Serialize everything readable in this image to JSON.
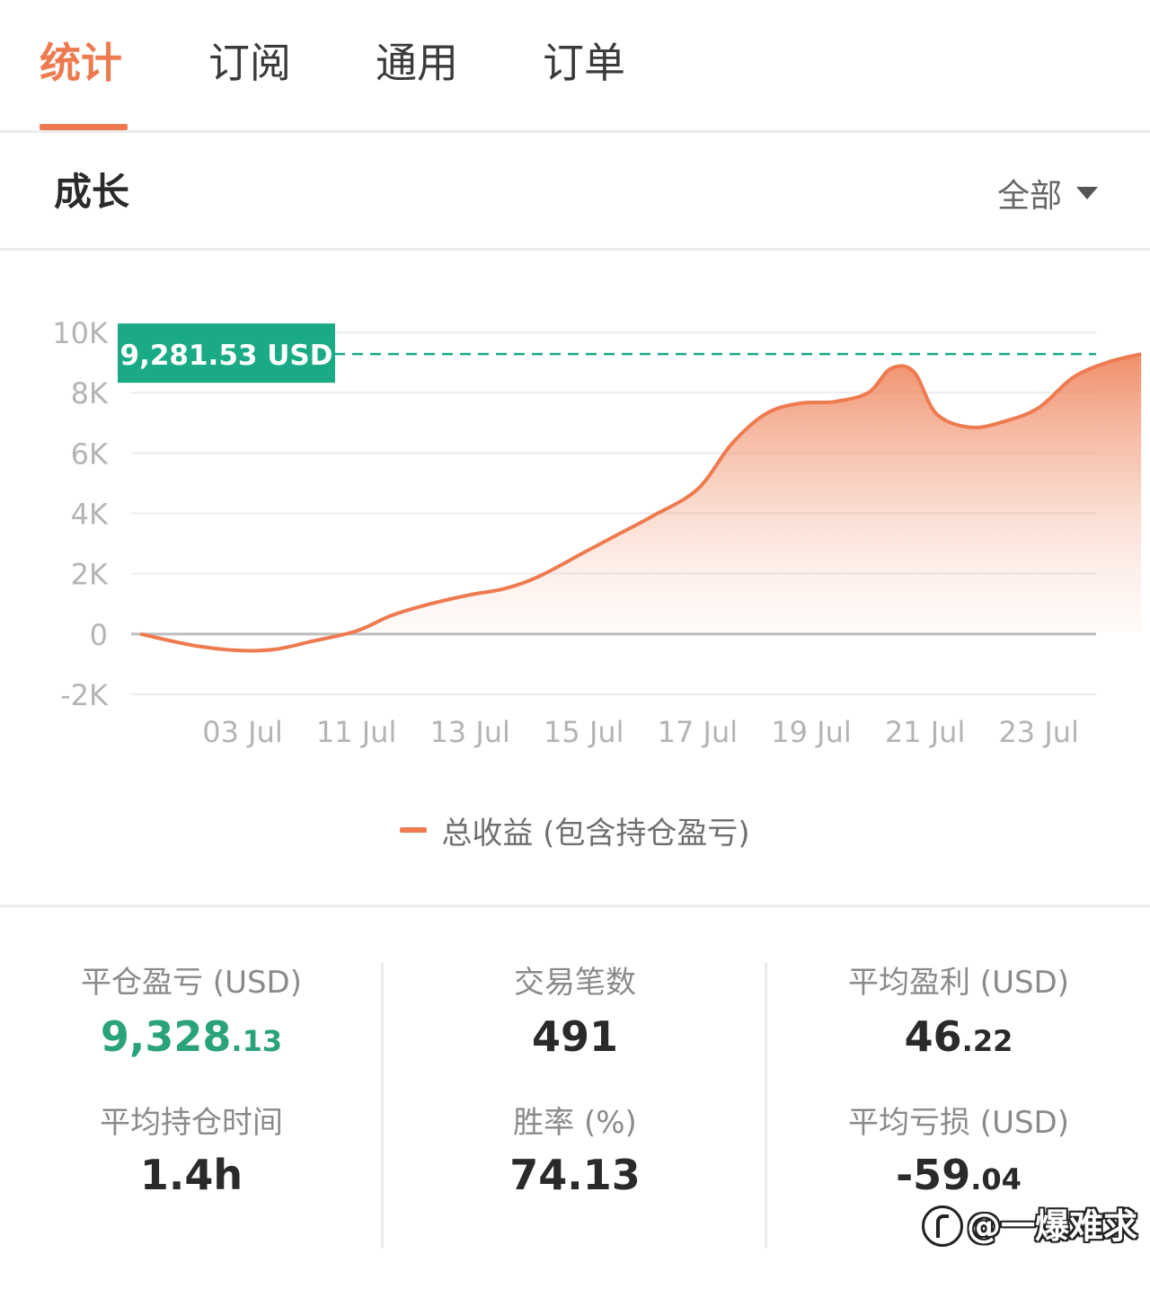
{
  "tabs": [
    {
      "label": "统计",
      "active": true
    },
    {
      "label": "订阅",
      "active": false
    },
    {
      "label": "通用",
      "active": false
    },
    {
      "label": "订单",
      "active": false
    }
  ],
  "section": {
    "title": "成长",
    "range_label": "全部"
  },
  "colors": {
    "accent": "#ee7a4f",
    "positive": "#2aa27c",
    "tooltip_bg": "#1aaa85"
  },
  "chart_data": {
    "type": "area",
    "x_ticks": [
      "03 Jul",
      "11 Jul",
      "13 Jul",
      "15 Jul",
      "17 Jul",
      "19 Jul",
      "21 Jul",
      "23 Jul"
    ],
    "y_ticks": [
      "10K",
      "8K",
      "6K",
      "4K",
      "2K",
      "0",
      "-2K"
    ],
    "ylim": [
      -2000,
      10000
    ],
    "grid": true,
    "legend_position": "bottom",
    "series": [
      {
        "name": "总收益 (包含持仓盈亏)",
        "points": [
          [
            -0.9,
            0
          ],
          [
            -0.4,
            -400
          ],
          [
            0,
            -550
          ],
          [
            0.3,
            -500
          ],
          [
            0.6,
            -250
          ],
          [
            1.0,
            100
          ],
          [
            1.3,
            600
          ],
          [
            1.6,
            950
          ],
          [
            2.0,
            1300
          ],
          [
            2.3,
            1500
          ],
          [
            2.6,
            1900
          ],
          [
            3.0,
            2700
          ],
          [
            3.3,
            3300
          ],
          [
            3.6,
            3900
          ],
          [
            4.0,
            4800
          ],
          [
            4.3,
            6300
          ],
          [
            4.6,
            7300
          ],
          [
            4.9,
            7650
          ],
          [
            5.2,
            7700
          ],
          [
            5.5,
            8000
          ],
          [
            5.7,
            8800
          ],
          [
            5.9,
            8700
          ],
          [
            6.1,
            7300
          ],
          [
            6.4,
            6850
          ],
          [
            6.7,
            7050
          ],
          [
            7.0,
            7500
          ],
          [
            7.3,
            8500
          ],
          [
            7.6,
            9000
          ],
          [
            7.9,
            9281.53
          ]
        ]
      }
    ],
    "annotation": {
      "value": 9281.53,
      "label": "9,281.53 USD"
    }
  },
  "stats": [
    {
      "label": "平仓盈亏 (USD)",
      "value_int": "9,328",
      "value_dec": ".13",
      "positive": true
    },
    {
      "label": "平均持仓时间",
      "value_int": "1.4h",
      "value_dec": "",
      "positive": false
    },
    {
      "label": "交易笔数",
      "value_int": "491",
      "value_dec": "",
      "positive": false
    },
    {
      "label": "胜率 (%)",
      "value_int": "74.13",
      "value_dec": "",
      "positive": false
    },
    {
      "label": "平均盈利 (USD)",
      "value_int": "46",
      "value_dec": ".22",
      "positive": false
    },
    {
      "label": "平均亏损 (USD)",
      "value_int": "-59",
      "value_dec": ".04",
      "positive": false
    }
  ],
  "watermark": {
    "text": "@一爆难求"
  }
}
